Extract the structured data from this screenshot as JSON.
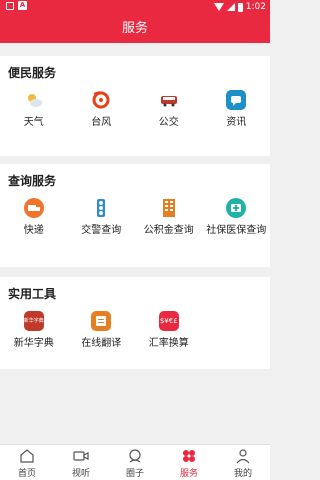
{
  "status": {
    "time": "1:02"
  },
  "header": {
    "title": "服务"
  },
  "sections": [
    {
      "title": "便民服务",
      "items": [
        {
          "label": "天气",
          "icon": "weather-icon"
        },
        {
          "label": "台风",
          "icon": "typhoon-icon"
        },
        {
          "label": "公交",
          "icon": "bus-icon"
        },
        {
          "label": "资讯",
          "icon": "news-icon"
        }
      ]
    },
    {
      "title": "查询服务",
      "items": [
        {
          "label": "快递",
          "icon": "express-icon"
        },
        {
          "label": "交警查询",
          "icon": "traffic-light-icon"
        },
        {
          "label": "公积金查询",
          "icon": "building-icon"
        },
        {
          "label": "社保医保查询",
          "icon": "medical-icon"
        }
      ]
    },
    {
      "title": "实用工具",
      "items": [
        {
          "label": "新华字典",
          "icon": "dictionary-icon",
          "icon_text": "新华字典"
        },
        {
          "label": "在线翻译",
          "icon": "translate-icon"
        },
        {
          "label": "汇率换算",
          "icon": "currency-icon",
          "icon_text": "$¥€£"
        }
      ]
    }
  ],
  "nav": [
    {
      "label": "首页",
      "icon": "home-icon"
    },
    {
      "label": "视听",
      "icon": "video-icon"
    },
    {
      "label": "圈子",
      "icon": "circle-icon"
    },
    {
      "label": "服务",
      "icon": "services-icon",
      "active": true
    },
    {
      "label": "我的",
      "icon": "profile-icon"
    }
  ]
}
